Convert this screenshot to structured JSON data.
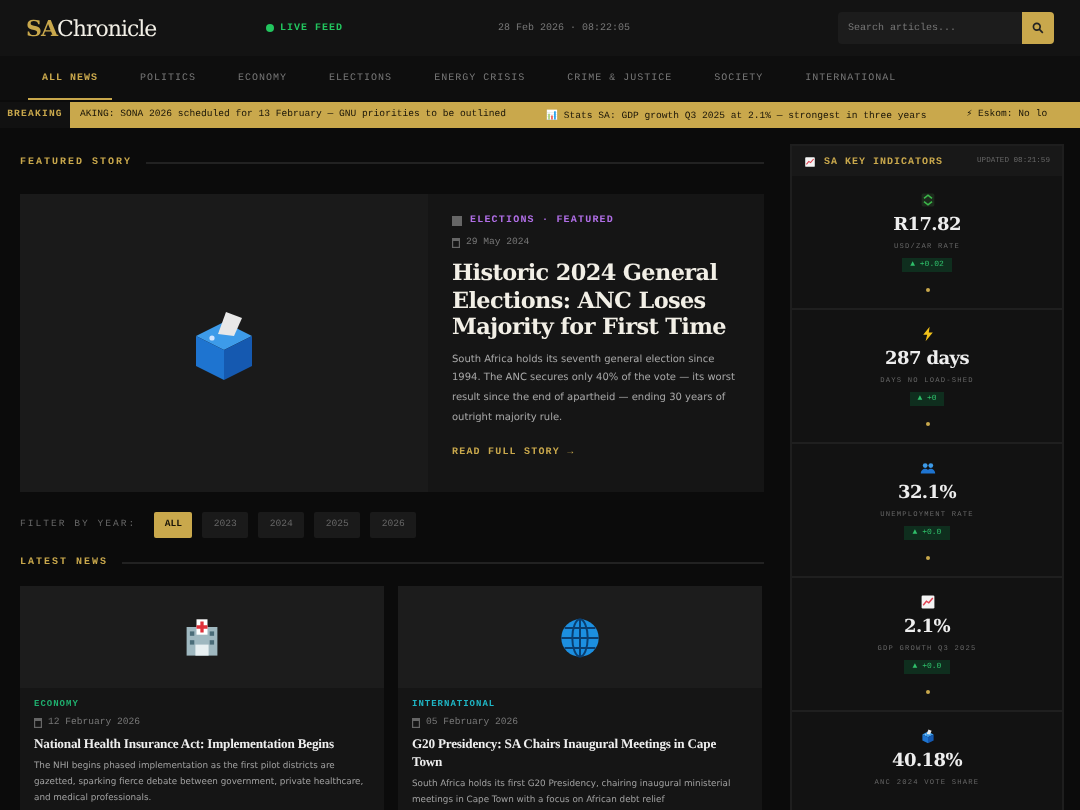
{
  "header": {
    "logo_accent": "SA",
    "logo_rest": "Chronicle",
    "live": "LIVE FEED",
    "datetime": "28 Feb 2026 · 08:22:05",
    "search": {
      "placeholder": "Search articles..."
    }
  },
  "nav": [
    {
      "label": "ALL NEWS",
      "selected": true
    },
    {
      "label": "POLITICS",
      "selected": false
    },
    {
      "label": "ECONOMY",
      "selected": false
    },
    {
      "label": "ELECTIONS",
      "selected": false
    },
    {
      "label": "ENERGY CRISIS",
      "selected": false
    },
    {
      "label": "CRIME & JUSTICE",
      "selected": false
    },
    {
      "label": "SOCIETY",
      "selected": false
    },
    {
      "label": "INTERNATIONAL",
      "selected": false
    }
  ],
  "ticker": {
    "label": "BREAKING",
    "items": [
      "AKING: SONA 2026 scheduled for 13 February — GNU priorities to be outlined",
      "📊 Stats SA: GDP growth Q3 2025 at 2.1% — strongest in three years",
      "⚡ Eskom: No lo"
    ]
  },
  "featured": {
    "heading": "FEATURED STORY",
    "category": "ELECTIONS · FEATURED",
    "date": "29 May 2024",
    "title": "Historic 2024 General Elections: ANC Loses Majority for First Time",
    "summary": "South Africa holds its seventh general election since 1994. The ANC secures only 40% of the vote — its worst result since the end of apartheid — ending 30 years of outright majority rule.",
    "link": "READ FULL STORY →"
  },
  "filter": {
    "label": "FILTER BY YEAR:",
    "years": [
      {
        "label": "ALL",
        "selected": true
      },
      {
        "label": "2023",
        "selected": false
      },
      {
        "label": "2024",
        "selected": false
      },
      {
        "label": "2025",
        "selected": false
      },
      {
        "label": "2026",
        "selected": false
      }
    ]
  },
  "latest": {
    "heading": "LATEST NEWS",
    "articles": [
      {
        "kind": "hospital",
        "category": "ECONOMY",
        "color": "#1fae6e",
        "date": "12 February 2026",
        "title": "National Health Insurance Act: Implementation Begins",
        "summary": "The NHI begins phased implementation as the first pilot districts are gazetted, sparking fierce debate between government, private healthcare, and medical professionals."
      },
      {
        "kind": "globe",
        "category": "INTERNATIONAL",
        "color": "#1fb5c4",
        "date": "05 February 2026",
        "title": "G20 Presidency: SA Chairs Inaugural Meetings in Cape Town",
        "summary": "South Africa holds its first G20 Presidency, chairing inaugural ministerial meetings in Cape Town with a focus on African debt relief"
      }
    ]
  },
  "indicators": {
    "title": "SA KEY INDICATORS",
    "updated": "UPDATED 08:21:59",
    "items": [
      {
        "kind": "currency",
        "value": "R17.82",
        "label": "USD/ZAR RATE",
        "change": "▲ +0.02"
      },
      {
        "kind": "bolt",
        "value": "287 days",
        "label": "DAYS NO LOAD-SHED",
        "change": "▲ +0"
      },
      {
        "kind": "people",
        "value": "32.1%",
        "label": "UNEMPLOYMENT RATE",
        "change": "▲ +0.0"
      },
      {
        "kind": "chart",
        "value": "2.1%",
        "label": "GDP GROWTH Q3 2025",
        "change": "▲ +0.0"
      },
      {
        "kind": "ballot",
        "value": "40.18%",
        "label": "ANC 2024 VOTE SHARE"
      }
    ]
  }
}
